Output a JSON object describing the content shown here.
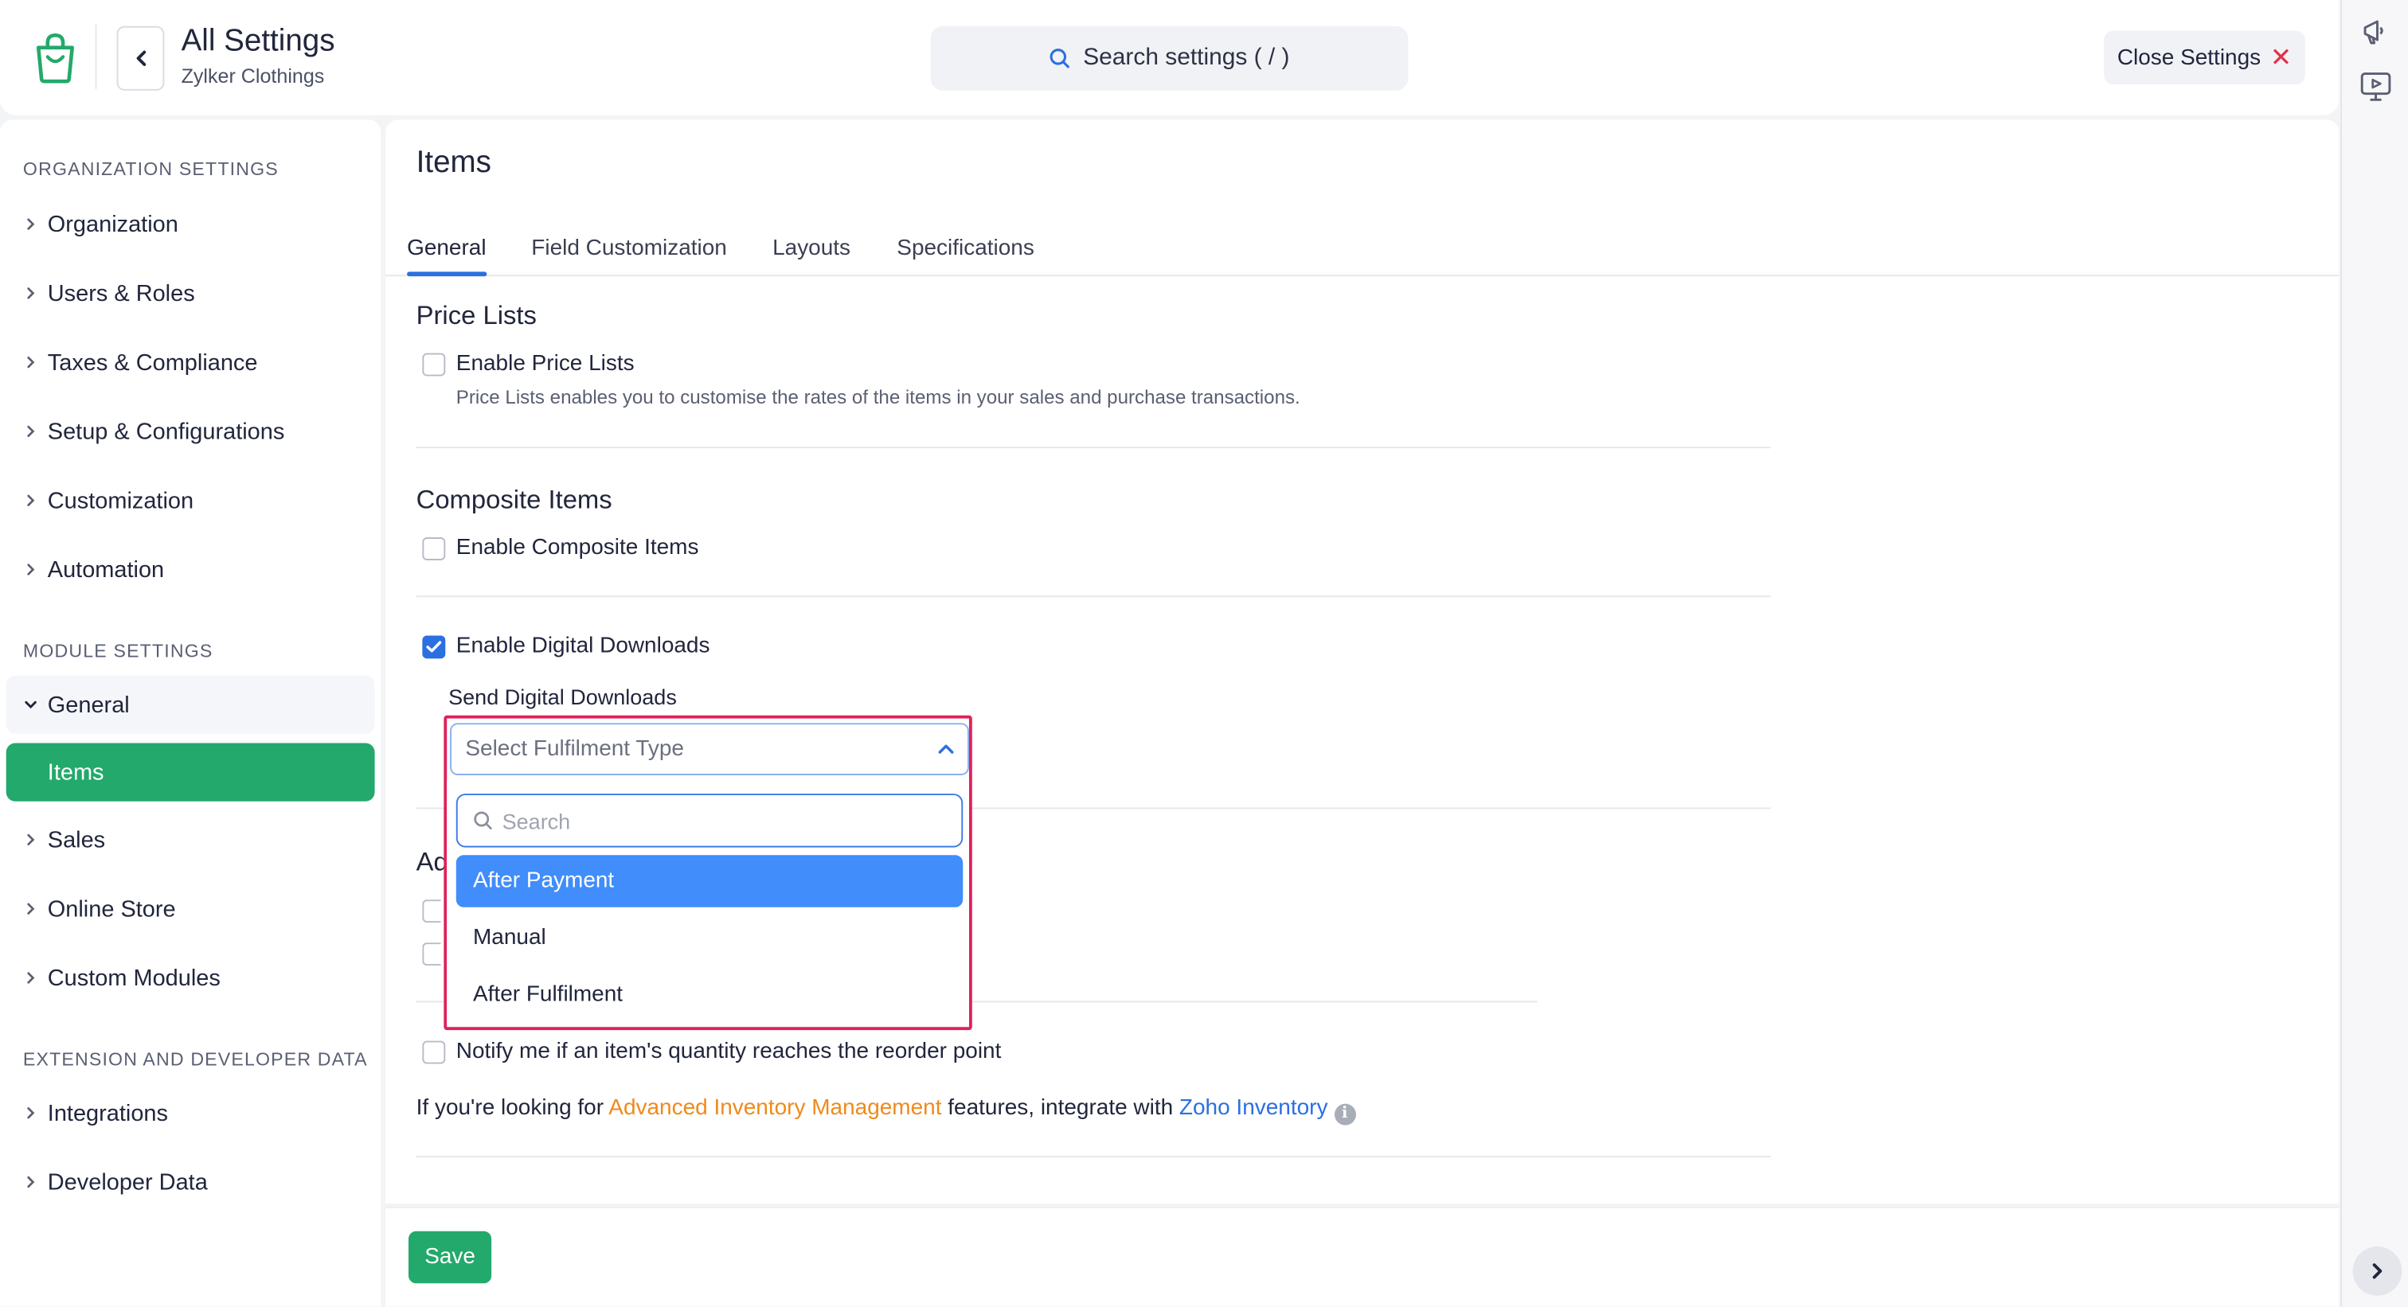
{
  "header": {
    "title": "All Settings",
    "org_name": "Zylker Clothings",
    "search_label": "Search settings ( / )",
    "close_label": "Close Settings"
  },
  "sidebar": {
    "org_section_title": "ORGANIZATION SETTINGS",
    "org_items": [
      "Organization",
      "Users & Roles",
      "Taxes & Compliance",
      "Setup & Configurations",
      "Customization",
      "Automation"
    ],
    "module_section_title": "MODULE SETTINGS",
    "module_general": "General",
    "module_items_active": "Items",
    "module_items": [
      "Sales",
      "Online Store",
      "Custom Modules"
    ],
    "ext_section_title": "EXTENSION AND DEVELOPER DATA",
    "ext_items": [
      "Integrations",
      "Developer Data"
    ]
  },
  "main": {
    "page_title": "Items",
    "tabs": [
      "General",
      "Field Customization",
      "Layouts",
      "Specifications"
    ],
    "price_lists": {
      "heading": "Price Lists",
      "checkbox_label": "Enable Price Lists",
      "checked": false,
      "help": "Price Lists enables you to customise the rates of the items in your sales and purchase transactions."
    },
    "composite": {
      "heading": "Composite Items",
      "checkbox_label": "Enable Composite Items",
      "checked": false
    },
    "digital": {
      "checkbox_label": "Enable Digital Downloads",
      "checked": true,
      "send_label": "Send Digital Downloads",
      "select_placeholder": "Select Fulfilment Type",
      "search_placeholder": "Search",
      "options": [
        "After Payment",
        "Manual",
        "After Fulfilment"
      ],
      "highlighted_option": "After Payment"
    },
    "partial_heading": "Ad",
    "notify": {
      "checkbox_label": "Notify me if an item's quantity reaches the reorder point",
      "checked": false
    },
    "info": {
      "prefix": "If you're looking for ",
      "link1": "Advanced Inventory Management",
      "middle": " features, integrate with ",
      "link2": "Zoho Inventory"
    }
  },
  "footer": {
    "save_label": "Save"
  },
  "colors": {
    "accent_green": "#23a96b",
    "accent_blue": "#2c6fe0",
    "selected_option": "#408dfb",
    "highlight_border": "#e0215a",
    "link_orange": "#ef8a1b"
  }
}
